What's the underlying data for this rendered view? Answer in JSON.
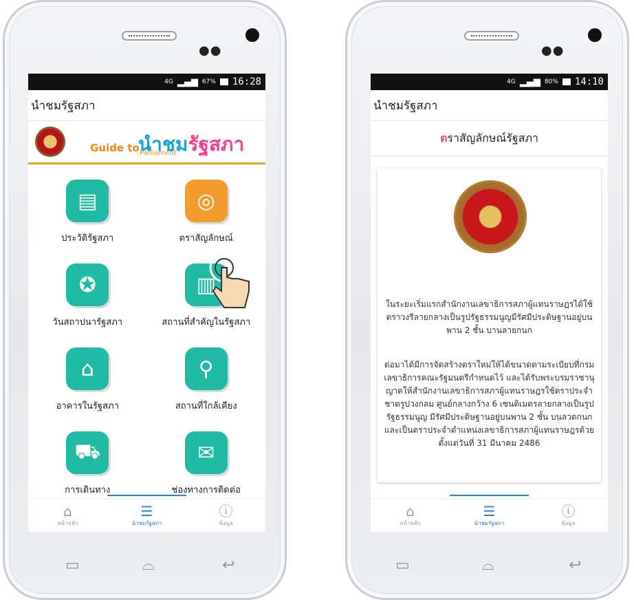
{
  "left_phone": {
    "status": {
      "network": "4G",
      "battery": "67%",
      "time": "16:28"
    },
    "app_title": "นำชมรัฐสภา",
    "banner": {
      "guide_to": "Guide to",
      "parliament": "Parliament",
      "brand_a": "นำชม",
      "brand_b": "รัฐสภา"
    },
    "menu": [
      {
        "label": "ประวัติรัฐสภา",
        "icon": "document-icon"
      },
      {
        "label": "ตราสัญลักษณ์",
        "icon": "seal-icon"
      },
      {
        "label": "วันสถาปนารัฐสภา",
        "icon": "award-icon"
      },
      {
        "label": "สถานที่สำคัญในรัฐสภา",
        "icon": "building-icon"
      },
      {
        "label": "อาคารในรัฐสภา",
        "icon": "parliament-building-icon"
      },
      {
        "label": "สถานที่ใกล้เคียง",
        "icon": "map-icon"
      },
      {
        "label": "การเดินทาง",
        "icon": "car-icon"
      },
      {
        "label": "ช่องทางการติดต่อ",
        "icon": "mail-icon"
      }
    ],
    "nav": [
      {
        "label": "หน้าหลัก"
      },
      {
        "label": "นำชมรัฐสภา"
      },
      {
        "label": "ข้อมูล"
      }
    ]
  },
  "right_phone": {
    "status": {
      "network": "4G",
      "battery": "80%",
      "time": "14:10"
    },
    "app_title": "นำชมรัฐสภา",
    "subtitle_first": "ต",
    "subtitle_rest": "ราสัญลักษณ์รัฐสภา",
    "para1": "ในระยะเริ่มแรกสำนักงานเลขาธิการสภาผู้แทนราษฎรได้ใช้ตราวงรีลายกลางเป็นรูปรัฐธรรมนูญมีรัศมีประดิษฐานอยู่บนพาน 2 ชั้น บานลายกนก",
    "para2": "ต่อมาได้มีการจัดสร้างตราใหม่ให้ได้ขนาดตามระเบียบที่กรมเลขาธิการคณะรัฐมนตรีกำหนดไว้ และได้รับพระบรมราชานุญาตให้สำนักงานเลขาธิการสภาผู้แทนราษฎรใช้ตราประจำชาตรูปวงกลม ศูนย์กลางกว้าง 6 เซนติเมตรลายกลางเป็นรูปรัฐธรรมนูญ มีรัศมีประดิษฐานอยู่บนพาน 2 ชั้น บนลวดกนกและเป็นตราประจำตำแหน่งเลขาธิการสภาผู้แทนราษฎรด้วย ตั้งแต่วันที่ 31 มีนาคม 2486",
    "nav": [
      {
        "label": "หน้าหลัก"
      },
      {
        "label": "นำชมรัฐสภา"
      },
      {
        "label": "ข้อมูล"
      }
    ]
  }
}
